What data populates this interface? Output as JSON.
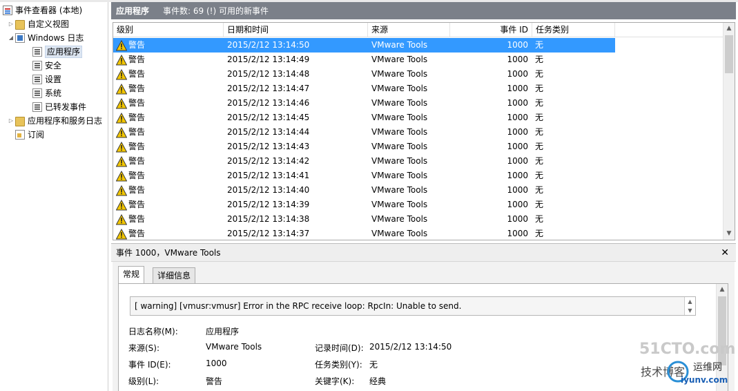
{
  "tree": {
    "root": "事件查看器 (本地)",
    "custom_views": "自定义视图",
    "windows_logs": "Windows 日志",
    "application": "应用程序",
    "security": "安全",
    "setup": "设置",
    "system": "系统",
    "forwarded": "已转发事件",
    "apps_services": "应用程序和服务日志",
    "subscriptions": "订阅"
  },
  "header": {
    "title": "应用程序",
    "summary": "事件数: 69 (!) 可用的新事件"
  },
  "grid": {
    "columns": [
      "级别",
      "日期和时间",
      "来源",
      "事件 ID",
      "任务类别"
    ],
    "rows": [
      {
        "level": "警告",
        "datetime": "2015/2/12 13:14:50",
        "source": "VMware Tools",
        "event_id": "1000",
        "task": "无"
      },
      {
        "level": "警告",
        "datetime": "2015/2/12 13:14:49",
        "source": "VMware Tools",
        "event_id": "1000",
        "task": "无"
      },
      {
        "level": "警告",
        "datetime": "2015/2/12 13:14:48",
        "source": "VMware Tools",
        "event_id": "1000",
        "task": "无"
      },
      {
        "level": "警告",
        "datetime": "2015/2/12 13:14:47",
        "source": "VMware Tools",
        "event_id": "1000",
        "task": "无"
      },
      {
        "level": "警告",
        "datetime": "2015/2/12 13:14:46",
        "source": "VMware Tools",
        "event_id": "1000",
        "task": "无"
      },
      {
        "level": "警告",
        "datetime": "2015/2/12 13:14:45",
        "source": "VMware Tools",
        "event_id": "1000",
        "task": "无"
      },
      {
        "level": "警告",
        "datetime": "2015/2/12 13:14:44",
        "source": "VMware Tools",
        "event_id": "1000",
        "task": "无"
      },
      {
        "level": "警告",
        "datetime": "2015/2/12 13:14:43",
        "source": "VMware Tools",
        "event_id": "1000",
        "task": "无"
      },
      {
        "level": "警告",
        "datetime": "2015/2/12 13:14:42",
        "source": "VMware Tools",
        "event_id": "1000",
        "task": "无"
      },
      {
        "level": "警告",
        "datetime": "2015/2/12 13:14:41",
        "source": "VMware Tools",
        "event_id": "1000",
        "task": "无"
      },
      {
        "level": "警告",
        "datetime": "2015/2/12 13:14:40",
        "source": "VMware Tools",
        "event_id": "1000",
        "task": "无"
      },
      {
        "level": "警告",
        "datetime": "2015/2/12 13:14:39",
        "source": "VMware Tools",
        "event_id": "1000",
        "task": "无"
      },
      {
        "level": "警告",
        "datetime": "2015/2/12 13:14:38",
        "source": "VMware Tools",
        "event_id": "1000",
        "task": "无"
      },
      {
        "level": "警告",
        "datetime": "2015/2/12 13:14:37",
        "source": "VMware Tools",
        "event_id": "1000",
        "task": "无"
      }
    ]
  },
  "detail": {
    "title": "事件 1000，VMware Tools",
    "close": "✕",
    "tab_general": "常规",
    "tab_details": "详细信息",
    "message": "[ warning] [vmusr:vmusr] Error in the RPC receive loop: RpcIn: Unable to send.",
    "log_name_label": "日志名称(M):",
    "log_name_value": "应用程序",
    "source_label": "来源(S):",
    "source_value": "VMware Tools",
    "logged_label": "记录时间(D):",
    "logged_value": "2015/2/12 13:14:50",
    "event_id_label": "事件 ID(E):",
    "event_id_value": "1000",
    "task_label": "任务类别(Y):",
    "task_value": "无",
    "level_label": "级别(L):",
    "level_value": "警告",
    "keywords_label": "关键字(K):",
    "keywords_value": "经典"
  },
  "watermark": {
    "line1": "51CTO.com",
    "line2": "技术博客",
    "line3": "运维网",
    "line4": "iyunv.com"
  },
  "colors": {
    "header_bg": "#7b8089",
    "selection": "#3399ff",
    "warning": "#f2c500"
  }
}
